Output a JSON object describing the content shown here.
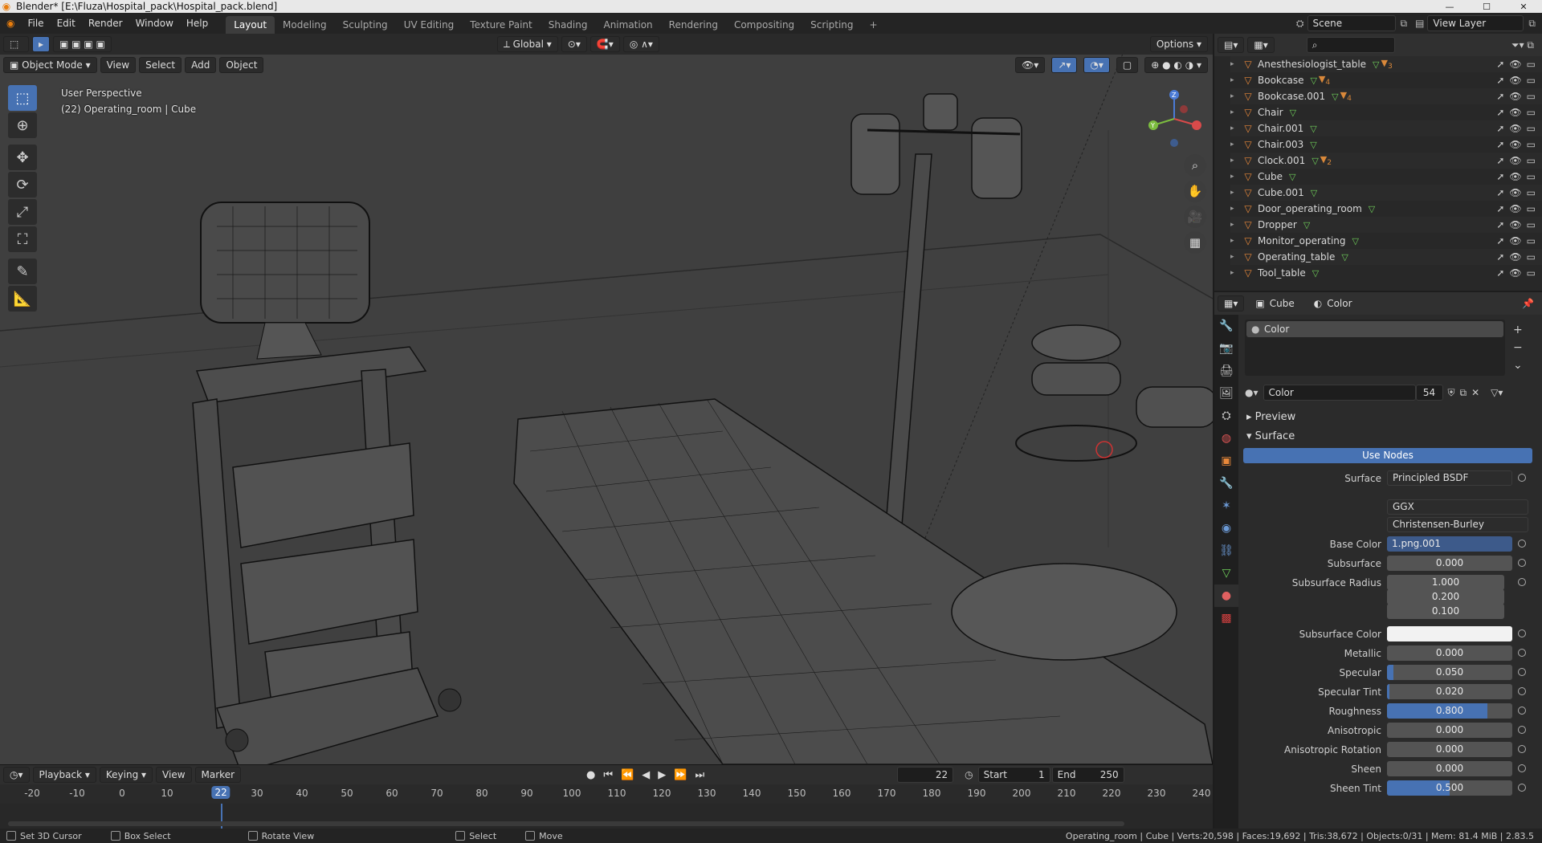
{
  "window": {
    "title": "Blender* [E:\\Fluza\\Hospital_pack\\Hospital_pack.blend]"
  },
  "menu": [
    "File",
    "Edit",
    "Render",
    "Window",
    "Help"
  ],
  "workspaces": [
    "Layout",
    "Modeling",
    "Sculpting",
    "UV Editing",
    "Texture Paint",
    "Shading",
    "Animation",
    "Rendering",
    "Compositing",
    "Scripting"
  ],
  "active_workspace": "Layout",
  "scene": {
    "name": "Scene",
    "view_layer": "View Layer"
  },
  "viewport": {
    "mode": "Object Mode",
    "menus": [
      "View",
      "Select",
      "Add",
      "Object"
    ],
    "transform_orientation": "Global",
    "options_label": "Options",
    "info_line1": "User Perspective",
    "info_line2": "(22) Operating_room | Cube"
  },
  "timeline": {
    "menus": [
      "Playback",
      "Keying",
      "View",
      "Marker"
    ],
    "current_frame": "22",
    "start_label": "Start",
    "start": "1",
    "end_label": "End",
    "end": "250",
    "ruler": [
      "-20",
      "-10",
      "0",
      "10",
      "30",
      "40",
      "50",
      "60",
      "70",
      "80",
      "90",
      "100",
      "110",
      "120",
      "130",
      "140",
      "150",
      "160",
      "170",
      "180",
      "190",
      "200",
      "210",
      "220",
      "230",
      "240"
    ],
    "cursor": "22"
  },
  "outliner": {
    "items": [
      {
        "name": "Anesthesiologist_table",
        "mats": "3"
      },
      {
        "name": "Bookcase",
        "mats": "4"
      },
      {
        "name": "Bookcase.001",
        "mats": "4"
      },
      {
        "name": "Chair",
        "mats": ""
      },
      {
        "name": "Chair.001",
        "mats": ""
      },
      {
        "name": "Chair.003",
        "mats": ""
      },
      {
        "name": "Clock.001",
        "mats": "2"
      },
      {
        "name": "Cube",
        "mats": ""
      },
      {
        "name": "Cube.001",
        "mats": ""
      },
      {
        "name": "Door_operating_room",
        "mats": ""
      },
      {
        "name": "Dropper",
        "mats": ""
      },
      {
        "name": "Monitor_operating",
        "mats": ""
      },
      {
        "name": "Operating_table",
        "mats": ""
      },
      {
        "name": "Tool_table",
        "mats": ""
      }
    ]
  },
  "properties": {
    "breadcrumb_object": "Cube",
    "breadcrumb_material": "Color",
    "slot_name": "Color",
    "material_name": "Color",
    "material_users": "54",
    "preview_label": "Preview",
    "surface_label": "Surface",
    "use_nodes_label": "Use Nodes",
    "surface_shader_label": "Surface",
    "surface_shader": "Principled BSDF",
    "distribution": "GGX",
    "subsurface_method": "Christensen-Burley",
    "fields": [
      {
        "label": "Base Color",
        "value": "1.png.001"
      },
      {
        "label": "Subsurface",
        "value": "0.000",
        "fill": 0
      },
      {
        "label": "Subsurface Radius",
        "value": "1.000"
      },
      {
        "label": "",
        "value": "0.200"
      },
      {
        "label": "",
        "value": "0.100"
      },
      {
        "label": "Subsurface Color",
        "value": ""
      },
      {
        "label": "Metallic",
        "value": "0.000",
        "fill": 0
      },
      {
        "label": "Specular",
        "value": "0.050",
        "fill": 0.05
      },
      {
        "label": "Specular Tint",
        "value": "0.020",
        "fill": 0.02
      },
      {
        "label": "Roughness",
        "value": "0.800",
        "fill": 0.8
      },
      {
        "label": "Anisotropic",
        "value": "0.000",
        "fill": 0
      },
      {
        "label": "Anisotropic Rotation",
        "value": "0.000",
        "fill": 0
      },
      {
        "label": "Sheen",
        "value": "0.000",
        "fill": 0
      },
      {
        "label": "Sheen Tint",
        "value": "0.500",
        "fill": 0.5
      }
    ]
  },
  "statusbar": {
    "left": [
      "Set 3D Cursor",
      "Box Select",
      "Rotate View",
      "Select",
      "Move"
    ],
    "right": "Operating_room | Cube | Verts:20,598 | Faces:19,692 | Tris:38,672 | Objects:0/31 | Mem: 81.4 MiB | 2.83.5"
  }
}
